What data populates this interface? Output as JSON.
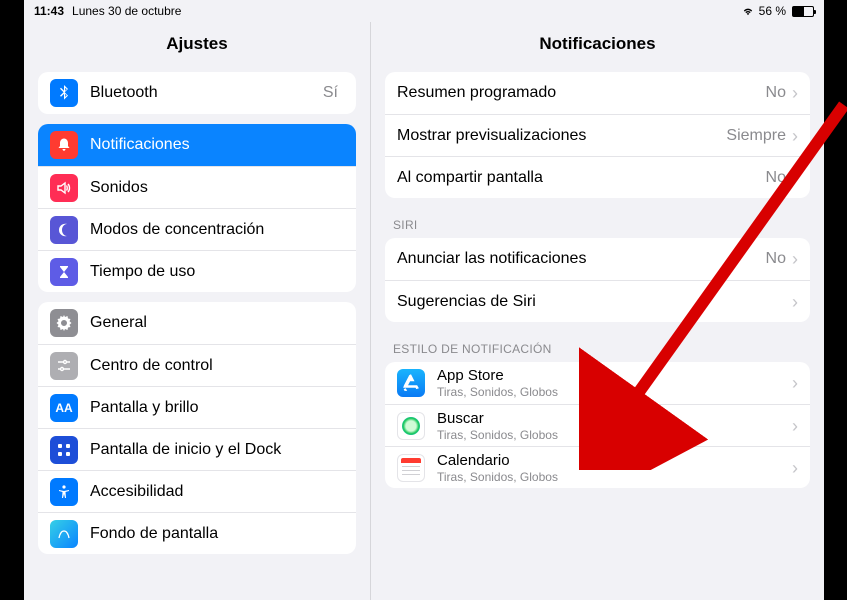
{
  "statusbar": {
    "time": "11:43",
    "date": "Lunes 30 de octubre",
    "battery_pct": "56 %"
  },
  "sidebar": {
    "title": "Ajustes",
    "items": [
      {
        "label": "Bluetooth",
        "value": "Sí"
      },
      {
        "label": "Notificaciones"
      },
      {
        "label": "Sonidos"
      },
      {
        "label": "Modos de concentración"
      },
      {
        "label": "Tiempo de uso"
      },
      {
        "label": "General"
      },
      {
        "label": "Centro de control"
      },
      {
        "label": "Pantalla y brillo"
      },
      {
        "label": "Pantalla de inicio y el Dock"
      },
      {
        "label": "Accesibilidad"
      },
      {
        "label": "Fondo de pantalla"
      }
    ]
  },
  "detail": {
    "title": "Notificaciones",
    "general": [
      {
        "label": "Resumen programado",
        "value": "No"
      },
      {
        "label": "Mostrar previsualizaciones",
        "value": "Siempre"
      },
      {
        "label": "Al compartir pantalla",
        "value": "No"
      }
    ],
    "siri_header": "SIRI",
    "siri": [
      {
        "label": "Anunciar las notificaciones",
        "value": "No"
      },
      {
        "label": "Sugerencias de Siri",
        "value": ""
      }
    ],
    "style_header": "ESTILO DE NOTIFICACIÓN",
    "apps": [
      {
        "label": "App Store",
        "sub": "Tiras, Sonidos, Globos"
      },
      {
        "label": "Buscar",
        "sub": "Tiras, Sonidos, Globos"
      },
      {
        "label": "Calendario",
        "sub": "Tiras, Sonidos, Globos"
      }
    ]
  }
}
